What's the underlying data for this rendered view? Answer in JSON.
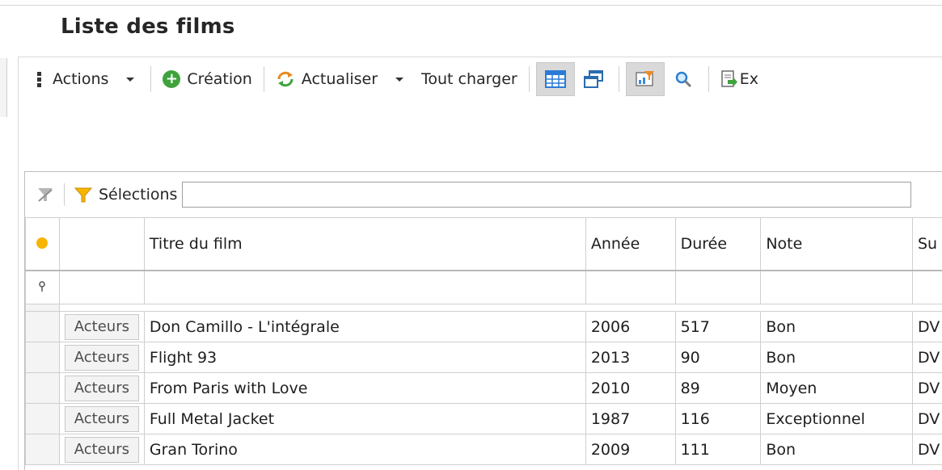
{
  "page": {
    "title": "Liste des films"
  },
  "toolbar": {
    "actions_label": "Actions",
    "creation_label": "Création",
    "refresh_label": "Actualiser",
    "load_all_label": "Tout charger",
    "export_label": "Ex"
  },
  "filter": {
    "selections_label": "Sélections"
  },
  "grid": {
    "columns": [
      "Titre du film",
      "Année",
      "Durée",
      "Note",
      "Su"
    ],
    "detail_button_label": "Acteurs",
    "rows": [
      {
        "title": "Don Camillo - L'intégrale",
        "year": "2006",
        "duration": "517",
        "rating": "Bon",
        "support": "DV"
      },
      {
        "title": "Flight 93",
        "year": "2013",
        "duration": "90",
        "rating": "Bon",
        "support": "DV"
      },
      {
        "title": "From Paris with Love",
        "year": "2010",
        "duration": "89",
        "rating": "Moyen",
        "support": "DV"
      },
      {
        "title": "Full Metal Jacket",
        "year": "1987",
        "duration": "116",
        "rating": "Exceptionnel",
        "support": "DV"
      },
      {
        "title": "Gran Torino",
        "year": "2009",
        "duration": "111",
        "rating": "Bon",
        "support": "DV"
      }
    ]
  },
  "colors": {
    "accent_green": "#3fa33c",
    "filter_yellow": "#f7b500",
    "refresh_orange": "#e58a1f"
  }
}
